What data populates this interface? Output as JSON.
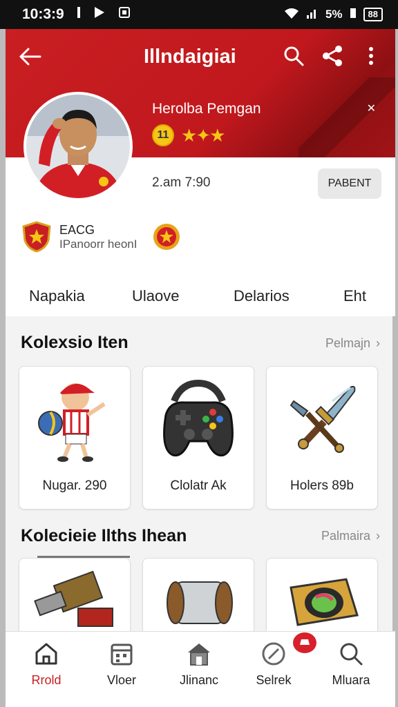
{
  "status_bar": {
    "time": "10:3:9",
    "left_icons": [
      "signal-bar-icon",
      "play-store-icon",
      "screen-icon"
    ],
    "signal_text": "5%",
    "battery": "88"
  },
  "header": {
    "title": "Illndaigiai",
    "player_name": "Herolba Pemgan",
    "rank": "11",
    "stars": "★✦★"
  },
  "profile": {
    "join_time": "2.am 7:90",
    "follow_label": "PABENT",
    "club_name": "EACG",
    "club_sub": "IPanoorr heonI"
  },
  "tabs": [
    "Napakia",
    "Ulaove",
    "Delarios",
    "Eht"
  ],
  "section1": {
    "title": "Kolexsio Iten",
    "link": "Pelmajn"
  },
  "section1_items": [
    {
      "label": "Nugar. 290"
    },
    {
      "label": "Clolatr Ak"
    },
    {
      "label": "Holers 89b"
    }
  ],
  "section2": {
    "title": "Kolecieie Ilths Ihean",
    "link": "Palmaira"
  },
  "bottom_nav": [
    {
      "label": "Rrold",
      "icon": "home-icon"
    },
    {
      "label": "Vloer",
      "icon": "calendar-icon"
    },
    {
      "label": "Jlinanc",
      "icon": "store-icon"
    },
    {
      "label": "Selrek",
      "icon": "compass-icon"
    },
    {
      "label": "Mluara",
      "icon": "search-icon"
    }
  ],
  "colors": {
    "primary": "#c91f23",
    "gold": "#f5c518"
  }
}
